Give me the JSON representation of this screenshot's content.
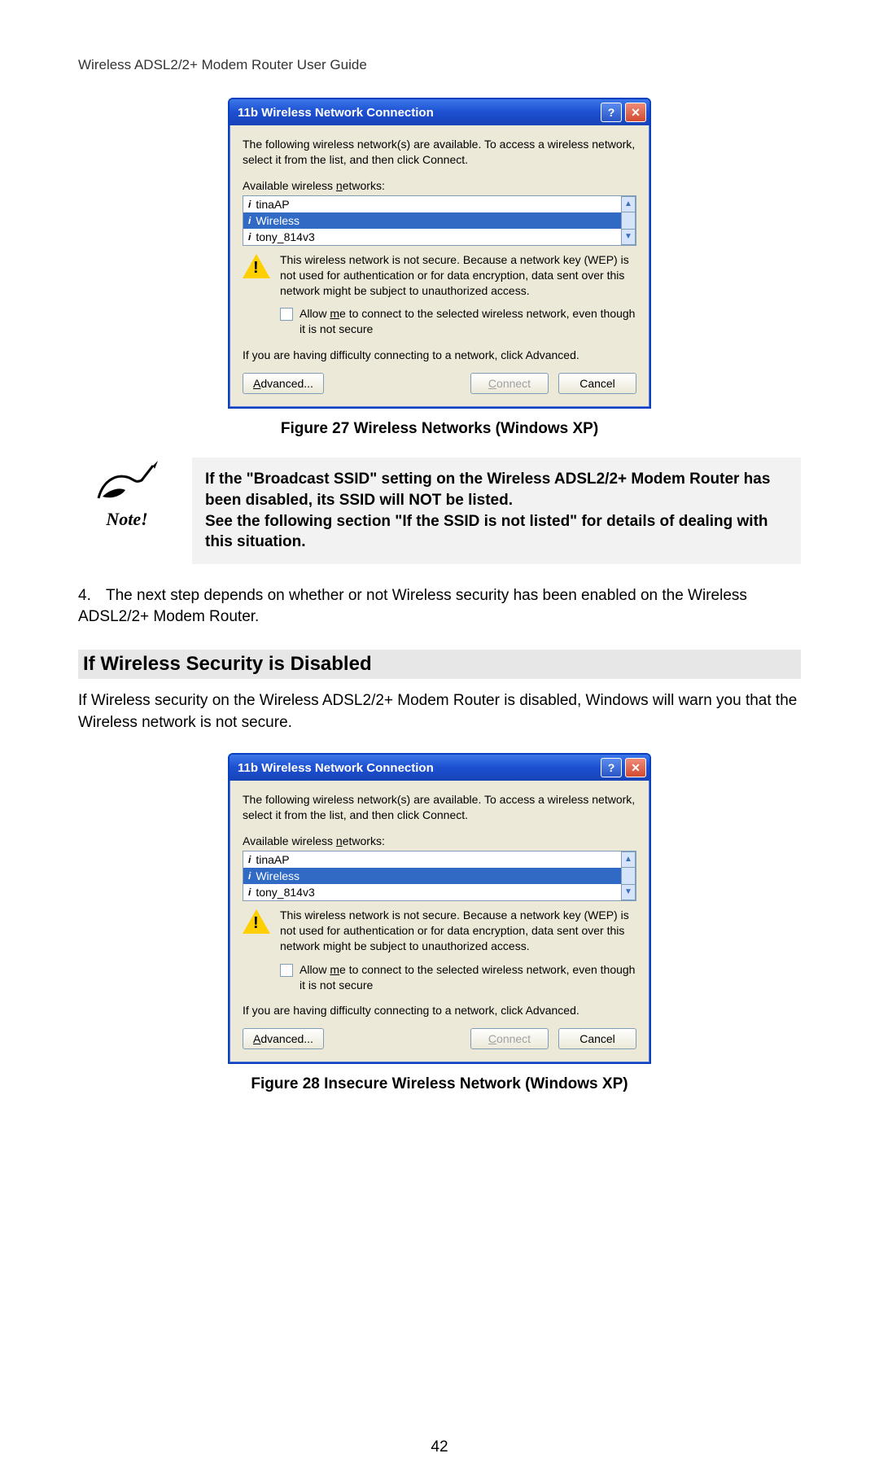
{
  "header": "Wireless ADSL2/2+ Modem Router User Guide",
  "dialog": {
    "title": "11b Wireless Network Connection",
    "help_label": "?",
    "close_label": "✕",
    "intro": "The following wireless network(s) are available. To access a wireless network, select it from the list, and then click Connect.",
    "available_label_pre": "Available wireless ",
    "available_label_u": "n",
    "available_label_post": "etworks:",
    "items": [
      {
        "name": "tinaAP",
        "selected": false
      },
      {
        "name": "Wireless",
        "selected": true
      },
      {
        "name": "tony_814v3",
        "selected": false
      }
    ],
    "scroll_up": "▲",
    "scroll_down": "▼",
    "warning": "This wireless network is not secure. Because a network key (WEP) is not used for authentication or for data encryption, data sent over this network might be subject to unauthorized access.",
    "allow_pre": "Allow ",
    "allow_u": "m",
    "allow_post": "e to connect to the selected wireless network, even though it is not secure",
    "difficulty": "If you are having difficulty connecting to a network, click Advanced.",
    "advanced_u": "A",
    "advanced_post": "dvanced...",
    "connect_u": "C",
    "connect_post": "onnect",
    "cancel": "Cancel"
  },
  "fig27": "Figure 27 Wireless Networks (Windows XP)",
  "note": {
    "label": "Note!",
    "text": "If the \"Broadcast SSID\" setting on the Wireless ADSL2/2+ Modem Router has been disabled, its SSID will NOT be listed.\nSee the following section \"If the SSID is not listed\" for details of dealing with this situation."
  },
  "step4_num": "4.",
  "step4": "The next step depends on whether or not Wireless security has been enabled on the Wireless ADSL2/2+ Modem Router.",
  "section_heading": "If Wireless Security is Disabled",
  "section_body": "If Wireless security on the Wireless ADSL2/2+ Modem Router is disabled, Windows will warn you that the Wireless network is not secure.",
  "fig28": "Figure 28 Insecure Wireless Network (Windows XP)",
  "page_number": "42"
}
